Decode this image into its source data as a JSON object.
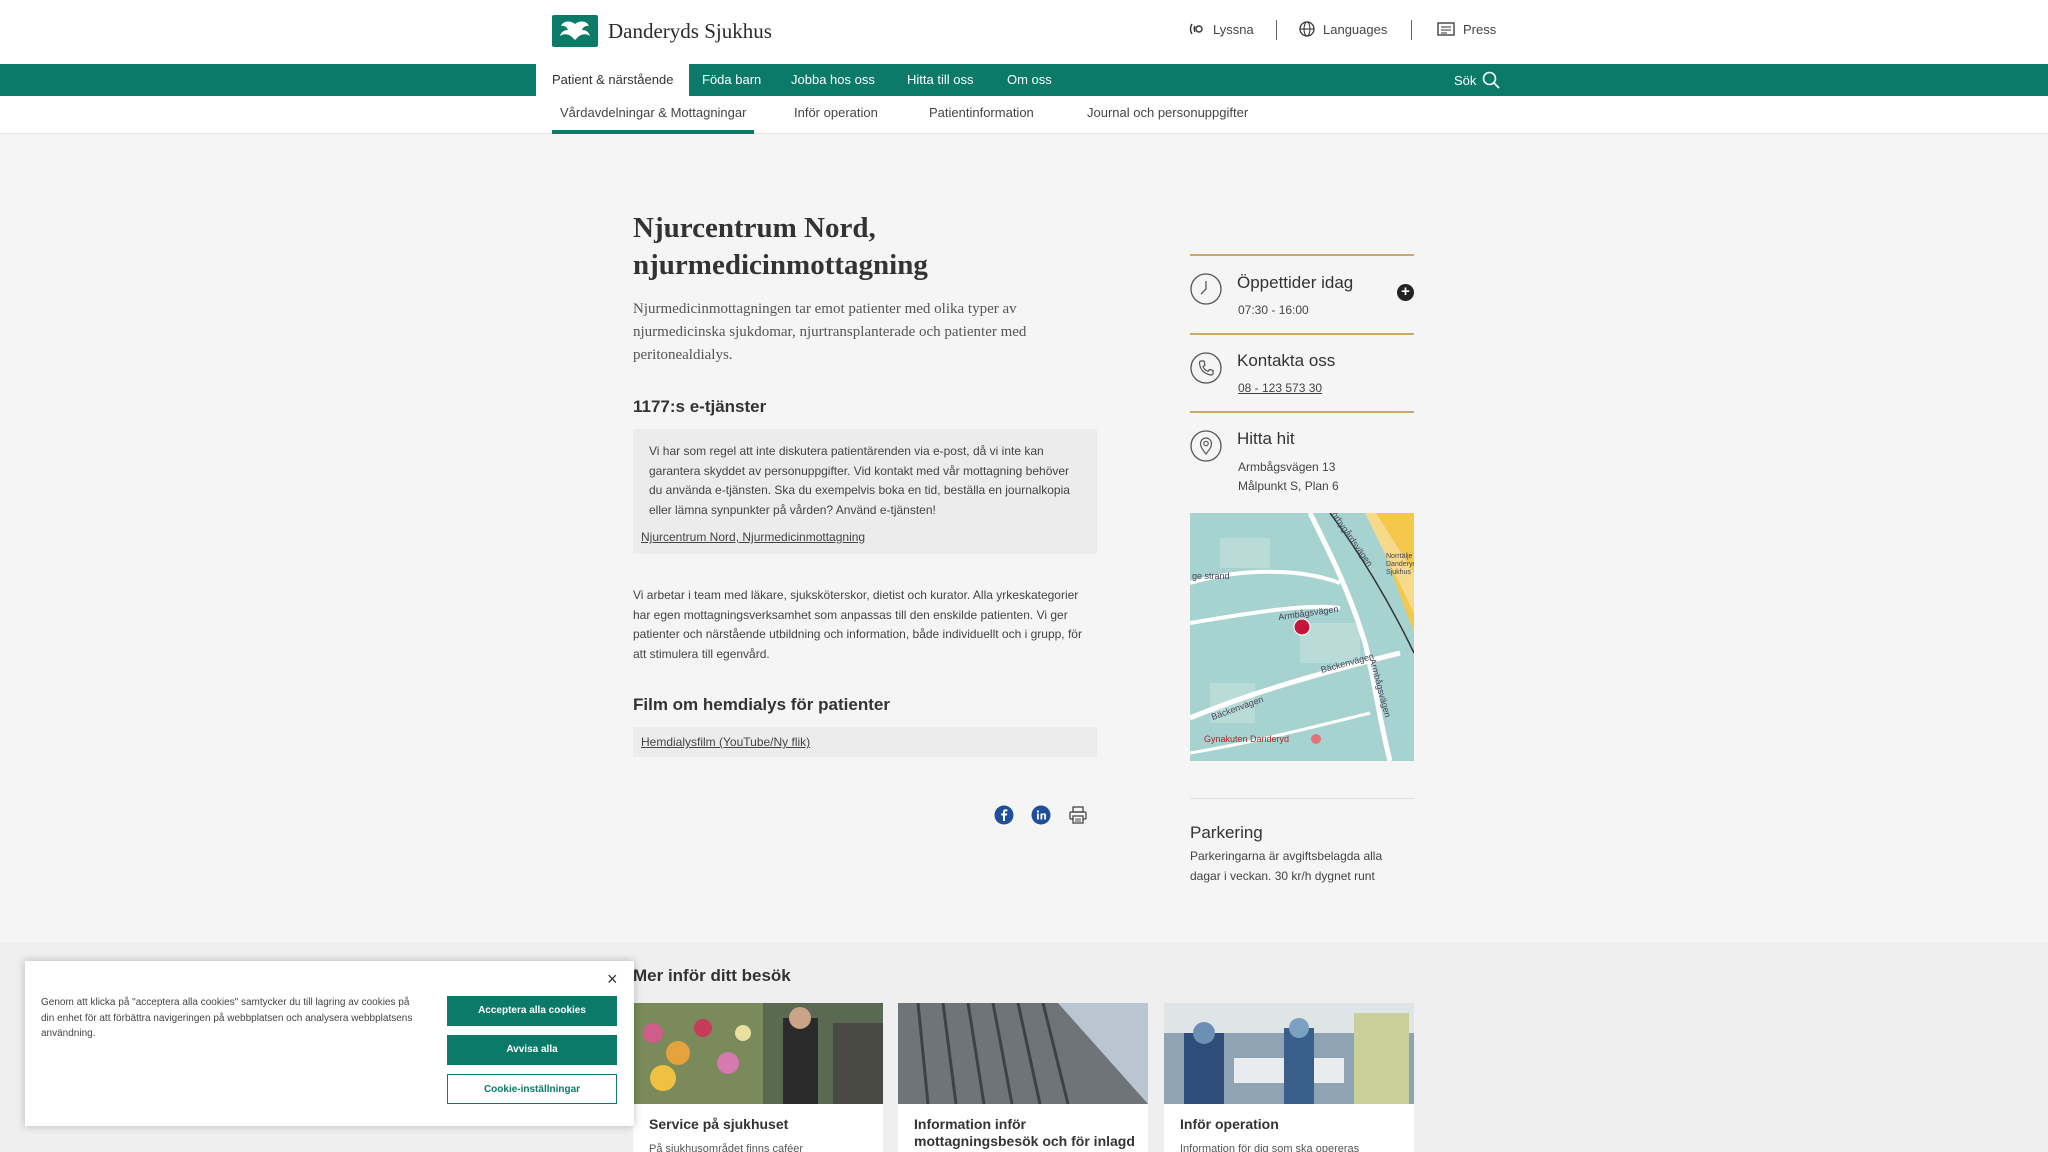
{
  "header": {
    "logo_text": "Danderyds Sjukhus",
    "listen_label": "Lyssna",
    "languages_label": "Languages",
    "press_label": "Press"
  },
  "mainnav": {
    "items": [
      "Patient & närstående",
      "Föda barn",
      "Jobba hos oss",
      "Hitta till oss",
      "Om oss"
    ],
    "search_label": "Sök"
  },
  "subnav": {
    "items": [
      "Vårdavdelningar & Mottagningar",
      "Inför operation",
      "Patientinformation",
      "Journal och personuppgifter"
    ]
  },
  "main": {
    "title": "Njurcentrum Nord, njurmedicinmottagning",
    "lead": "Njurmedicinmottagningen tar emot patienter med olika typer av njurmedicinska sjukdomar, njurtransplanterade och patienter med peritonealdialys.",
    "eservices_heading": "1177:s e-tjänster",
    "eservices_text": "Vi har som regel att inte diskutera patientärenden via e-post, då vi inte kan garantera skyddet av personuppgifter. Vid kontakt med vår mottagning behöver du använda e-tjänsten. Ska du exempelvis boka en tid, beställa en journalkopia eller lämna synpunkter på vården? Använd e-tjänsten!",
    "eservices_link": "Njurcentrum Nord, Njurmedicinmottagning",
    "body": "Vi arbetar i team med läkare, sjuksköterskor, dietist och kurator. Alla yrkeskategorier har egen mottagningsverksamhet som anpassas till den enskilde patienten. Vi ger patienter och närstående utbildning och information, både individuellt och i grupp, för att stimulera till egenvård.",
    "film_heading": "Film om hemdialys för patienter",
    "film_link": "Hemdialysfilm (YouTube/Ny flik)"
  },
  "sidebar": {
    "hours_heading": "Öppettider idag",
    "hours_value": "07:30 - 16:00",
    "contact_heading": "Kontakta oss",
    "contact_phone": "08 - 123 573 30",
    "find_heading": "Hitta hit",
    "address_line1": "Armbågsvägen 13",
    "address_line2": "Målpunkt S, Plan 6",
    "map_labels": {
      "road1": "Mörbygårdsvägen",
      "road2": "Armbågsvägen",
      "road3": "Bäckenvägen",
      "road4": "Bäckenvägen",
      "road5": "Armbågsvägen",
      "strand": "ge strand",
      "place": "Gynakuten Danderyd",
      "poi": "Norrtälje Danderyds Sjukhus"
    },
    "parking_heading": "Parkering",
    "parking_text": "Parkeringarna är avgiftsbelagda alla dagar i veckan. 30 kr/h dygnet runt"
  },
  "lower": {
    "heading": "Mer inför ditt besök",
    "cards": [
      {
        "title": "Service på sjukhuset",
        "subtitle": "På sjukhusområdet finns caféer"
      },
      {
        "title": "Information inför mottagningsbesök och för inlagd",
        "subtitle": ""
      },
      {
        "title": "Inför operation",
        "subtitle": "Information för dig som ska opereras"
      }
    ]
  },
  "cookie": {
    "text": "Genom att klicka på \"acceptera alla cookies\" samtycker du till lagring av cookies på din enhet för att förbättra navigeringen på webbplatsen och analysera webbplatsens användning.",
    "accept_label": "Acceptera alla cookies",
    "reject_label": "Avvisa alla",
    "settings_label": "Cookie-inställningar",
    "close_symbol": "×"
  },
  "colors": {
    "brand": "#0b7a69",
    "accent_line": "#c8a96a",
    "map_pin": "#c4163c"
  }
}
